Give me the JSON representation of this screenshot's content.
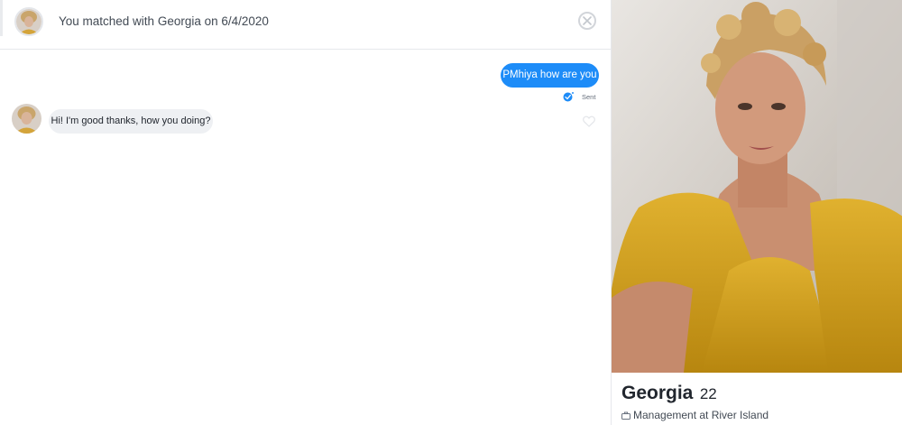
{
  "chat": {
    "header_text": "You matched with Georgia on 6/4/2020",
    "messages": [
      {
        "direction": "sent",
        "text": "PMhiya how are you",
        "status": "Sent"
      },
      {
        "direction": "received",
        "text": "Hi! I'm good thanks, how you doing?"
      }
    ]
  },
  "profile": {
    "name": "Georgia",
    "age": "22",
    "job": "Management at River Island"
  },
  "icons": {
    "close": "close-icon",
    "read_receipt": "read-receipt-icon",
    "like": "heart-icon",
    "job": "briefcase-icon"
  },
  "colors": {
    "sent_bubble": "#1d8cf8",
    "received_bubble": "#eef0f3",
    "text": "#21262e"
  }
}
